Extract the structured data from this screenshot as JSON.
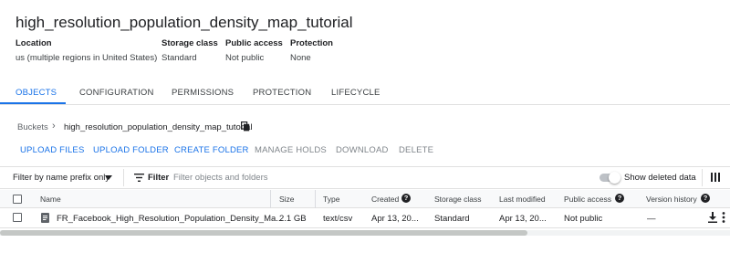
{
  "bucket": {
    "name": "high_resolution_population_density_map_tutorial"
  },
  "details": [
    {
      "label": "Location",
      "value": "us (multiple regions in United States)"
    },
    {
      "label": "Storage class",
      "value": "Standard"
    },
    {
      "label": "Public access",
      "value": "Not public"
    },
    {
      "label": "Protection",
      "value": "None"
    }
  ],
  "tabs": [
    {
      "label": "OBJECTS",
      "active": true
    },
    {
      "label": "CONFIGURATION",
      "active": false
    },
    {
      "label": "PERMISSIONS",
      "active": false
    },
    {
      "label": "PROTECTION",
      "active": false
    },
    {
      "label": "LIFECYCLE",
      "active": false
    }
  ],
  "breadcrumb": {
    "root": "Buckets",
    "current": "high_resolution_population_density_map_tutorial"
  },
  "actions": [
    {
      "label": "UPLOAD FILES",
      "enabled": true
    },
    {
      "label": "UPLOAD FOLDER",
      "enabled": true
    },
    {
      "label": "CREATE FOLDER",
      "enabled": true
    },
    {
      "label": "MANAGE HOLDS",
      "enabled": false
    },
    {
      "label": "DOWNLOAD",
      "enabled": false
    },
    {
      "label": "DELETE",
      "enabled": false
    }
  ],
  "filter": {
    "prefix_label": "Filter by name prefix only",
    "filter_label": "Filter",
    "placeholder": "Filter objects and folders",
    "show_deleted_label": "Show deleted data",
    "show_deleted_on": false
  },
  "table": {
    "columns": [
      "Name",
      "Size",
      "Type",
      "Created",
      "Storage class",
      "Last modified",
      "Public access",
      "Version history"
    ],
    "rows": [
      {
        "name": "FR_Facebook_High_Resolution_Population_Density_Ma...",
        "size": "2.1 GB",
        "type": "text/csv",
        "created": "Apr 13, 20...",
        "storage_class": "Standard",
        "last_modified": "Apr 13, 20...",
        "public_access": "Not public",
        "version_history": "—"
      }
    ]
  },
  "icons": {
    "copy": "copy-icon",
    "chevron": "chevron-right-icon",
    "filter": "filter-lines-icon",
    "help": "help-icon",
    "file": "file-icon",
    "download": "download-icon",
    "more": "kebab-icon",
    "columns": "columns-icon"
  },
  "colors": {
    "accent": "#1a73e8",
    "disabled": "#80868b",
    "text": "#202124"
  }
}
